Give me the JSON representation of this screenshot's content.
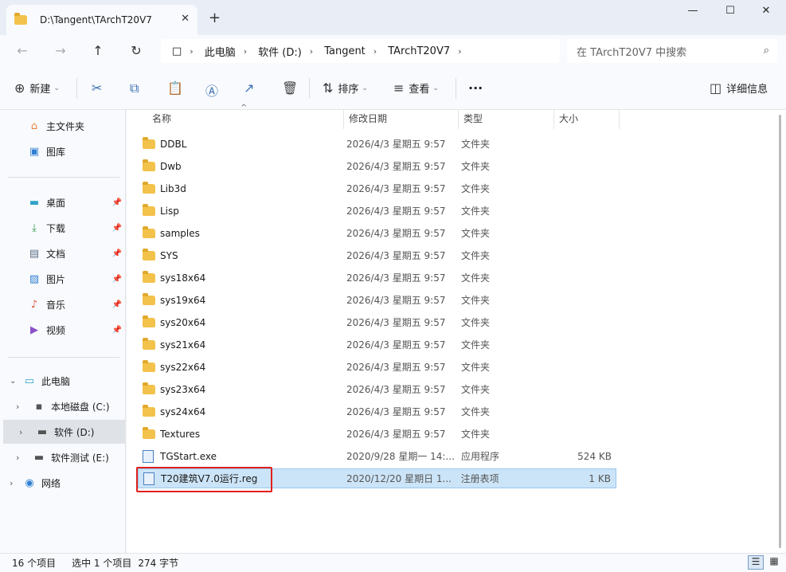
{
  "window": {
    "tab_title": "D:\\Tangent\\TArchT20V7",
    "tab_close": "✕",
    "new_tab": "+",
    "minimize": "—",
    "maximize": "☐",
    "close": "✕"
  },
  "nav": {
    "back": "←",
    "forward": "→",
    "up": "↑",
    "refresh": "↻"
  },
  "address": {
    "segments": [
      "此电脑",
      "软件 (D:)",
      "Tangent",
      "TArchT20V7"
    ],
    "chevron": "›",
    "monitor_icon": "□"
  },
  "search": {
    "placeholder": "在 TArchT20V7 中搜索",
    "icon": "⌕"
  },
  "toolbar": {
    "new_label": "新建",
    "sort_label": "排序",
    "view_label": "查看",
    "more": "···",
    "details_label": "详细信息",
    "icons": {
      "new": "⊕",
      "cut": "✂",
      "copy": "⧉",
      "paste": "📋",
      "rename": "Ⓐ",
      "share": "↗",
      "delete": "🗑",
      "sort": "⇅",
      "view": "≡",
      "details": "◫",
      "dropdown": "⌄"
    }
  },
  "sidebar": {
    "quick": [
      {
        "label": "主文件夹",
        "icon": "⌂",
        "color": "#e8833a"
      },
      {
        "label": "图库",
        "icon": "▣",
        "color": "#2f7fd1"
      }
    ],
    "pinned": [
      {
        "label": "桌面",
        "icon": "▬",
        "color": "#2ea3c6"
      },
      {
        "label": "下载",
        "icon": "⤓",
        "color": "#2e9b4d"
      },
      {
        "label": "文档",
        "icon": "▤",
        "color": "#5b6e86"
      },
      {
        "label": "图片",
        "icon": "▨",
        "color": "#2f7fd1"
      },
      {
        "label": "音乐",
        "icon": "♪",
        "color": "#e0543b"
      },
      {
        "label": "视频",
        "icon": "▶",
        "color": "#8a4fc7"
      }
    ],
    "pin_icon": "📌",
    "tree": [
      {
        "label": "此电脑",
        "icon": "▭",
        "expander": "⌄"
      },
      {
        "label": "本地磁盘 (C:)",
        "icon": "▪",
        "expander": "›"
      },
      {
        "label": "软件 (D:)",
        "icon": "▬",
        "expander": "›"
      },
      {
        "label": "软件测试 (E:)",
        "icon": "▬",
        "expander": "›"
      },
      {
        "label": "网络",
        "icon": "◉",
        "expander": "›"
      }
    ]
  },
  "columns": [
    "名称",
    "修改日期",
    "类型",
    "大小"
  ],
  "sort_indicator": "^",
  "files": [
    {
      "name": "DDBL",
      "date": "2026/4/3 星期五 9:57",
      "type": "文件夹",
      "size": ""
    },
    {
      "name": "Dwb",
      "date": "2026/4/3 星期五 9:57",
      "type": "文件夹",
      "size": ""
    },
    {
      "name": "Lib3d",
      "date": "2026/4/3 星期五 9:57",
      "type": "文件夹",
      "size": ""
    },
    {
      "name": "Lisp",
      "date": "2026/4/3 星期五 9:57",
      "type": "文件夹",
      "size": ""
    },
    {
      "name": "samples",
      "date": "2026/4/3 星期五 9:57",
      "type": "文件夹",
      "size": ""
    },
    {
      "name": "SYS",
      "date": "2026/4/3 星期五 9:57",
      "type": "文件夹",
      "size": ""
    },
    {
      "name": "sys18x64",
      "date": "2026/4/3 星期五 9:57",
      "type": "文件夹",
      "size": ""
    },
    {
      "name": "sys19x64",
      "date": "2026/4/3 星期五 9:57",
      "type": "文件夹",
      "size": ""
    },
    {
      "name": "sys20x64",
      "date": "2026/4/3 星期五 9:57",
      "type": "文件夹",
      "size": ""
    },
    {
      "name": "sys21x64",
      "date": "2026/4/3 星期五 9:57",
      "type": "文件夹",
      "size": ""
    },
    {
      "name": "sys22x64",
      "date": "2026/4/3 星期五 9:57",
      "type": "文件夹",
      "size": ""
    },
    {
      "name": "sys23x64",
      "date": "2026/4/3 星期五 9:57",
      "type": "文件夹",
      "size": ""
    },
    {
      "name": "sys24x64",
      "date": "2026/4/3 星期五 9:57",
      "type": "文件夹",
      "size": ""
    },
    {
      "name": "Textures",
      "date": "2026/4/3 星期五 9:57",
      "type": "文件夹",
      "size": ""
    },
    {
      "name": "TGStart.exe",
      "date": "2020/9/28 星期一 14:...",
      "type": "应用程序",
      "size": "524 KB",
      "kind": "exe"
    },
    {
      "name": "T20建筑V7.0运行.reg",
      "date": "2020/12/20 星期日 1...",
      "type": "注册表项",
      "size": "1 KB",
      "kind": "reg",
      "selected": true
    }
  ],
  "status": {
    "count": "16 个项目",
    "selected": "选中 1 个项目",
    "bytes": "274 字节",
    "details_view": "☰",
    "tiles_view": "▦"
  }
}
